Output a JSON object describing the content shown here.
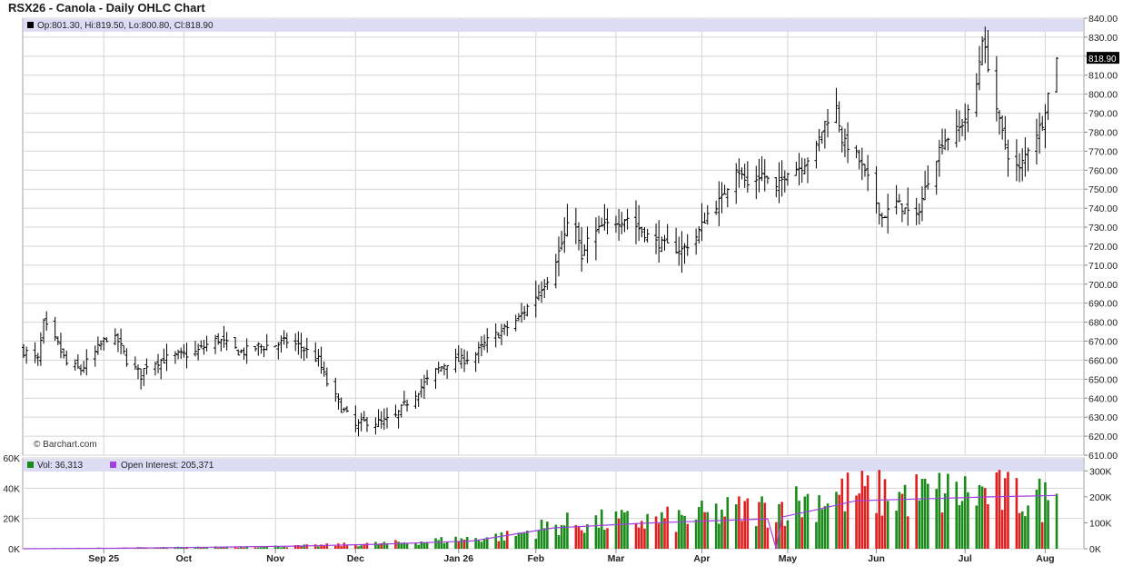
{
  "chart_data": [
    {
      "type": "ohlc",
      "title": "RSX26 - Canola - Daily OHLC Chart",
      "watermark": "© Barchart.com",
      "legend": {
        "open_label": "Op:",
        "open": "801.30",
        "high_label": "Hi:",
        "high": "819.50",
        "low_label": "Lo:",
        "low": "800.80",
        "close_label": "Cl:",
        "close": "818.90"
      },
      "last_price_label": "818.90",
      "ylim": [
        610,
        840
      ],
      "y_ticks": [
        "840.00",
        "830.00",
        "820.00",
        "810.00",
        "800.00",
        "790.00",
        "780.00",
        "770.00",
        "760.00",
        "750.00",
        "740.00",
        "730.00",
        "720.00",
        "710.00",
        "700.00",
        "690.00",
        "680.00",
        "670.00",
        "660.00",
        "650.00",
        "640.00",
        "630.00",
        "620.00",
        "610.00"
      ],
      "x_ticks": [
        "Sep 25",
        "Oct",
        "Nov",
        "Dec",
        "Jan 26",
        "Feb",
        "Mar",
        "Apr",
        "May",
        "Jun",
        "Jul",
        "Aug"
      ],
      "close_series": [
        {
          "d": "2025-08-28",
          "v": 665
        },
        {
          "d": "2025-09-02",
          "v": 660
        },
        {
          "d": "2025-09-04",
          "v": 679
        },
        {
          "d": "2025-09-09",
          "v": 668
        },
        {
          "d": "2025-09-12",
          "v": 658
        },
        {
          "d": "2025-09-17",
          "v": 655
        },
        {
          "d": "2025-09-22",
          "v": 664
        },
        {
          "d": "2025-09-26",
          "v": 672
        },
        {
          "d": "2025-09-30",
          "v": 670
        },
        {
          "d": "2025-10-03",
          "v": 660
        },
        {
          "d": "2025-10-08",
          "v": 652
        },
        {
          "d": "2025-10-10",
          "v": 658
        },
        {
          "d": "2025-10-15",
          "v": 660
        },
        {
          "d": "2025-10-20",
          "v": 662
        },
        {
          "d": "2025-10-27",
          "v": 664
        },
        {
          "d": "2025-10-31",
          "v": 668
        },
        {
          "d": "2025-11-04",
          "v": 671
        },
        {
          "d": "2025-11-07",
          "v": 668
        },
        {
          "d": "2025-11-12",
          "v": 664
        },
        {
          "d": "2025-11-18",
          "v": 667
        },
        {
          "d": "2025-11-24",
          "v": 668
        },
        {
          "d": "2025-11-28",
          "v": 670
        },
        {
          "d": "2025-12-03",
          "v": 667
        },
        {
          "d": "2025-12-09",
          "v": 660
        },
        {
          "d": "2025-12-12",
          "v": 648
        },
        {
          "d": "2025-12-17",
          "v": 635
        },
        {
          "d": "2025-12-22",
          "v": 625
        },
        {
          "d": "2025-12-26",
          "v": 628
        },
        {
          "d": "2025-12-31",
          "v": 627
        },
        {
          "d": "2026-01-05",
          "v": 630
        },
        {
          "d": "2026-01-09",
          "v": 638
        },
        {
          "d": "2026-01-14",
          "v": 646
        },
        {
          "d": "2026-01-19",
          "v": 654
        },
        {
          "d": "2026-01-23",
          "v": 659
        },
        {
          "d": "2026-01-28",
          "v": 660
        },
        {
          "d": "2026-02-02",
          "v": 663
        },
        {
          "d": "2026-02-06",
          "v": 670
        },
        {
          "d": "2026-02-11",
          "v": 675
        },
        {
          "d": "2026-02-17",
          "v": 682
        },
        {
          "d": "2026-02-23",
          "v": 694
        },
        {
          "d": "2026-02-27",
          "v": 703
        },
        {
          "d": "2026-03-03",
          "v": 717
        },
        {
          "d": "2026-03-06",
          "v": 730
        },
        {
          "d": "2026-03-09",
          "v": 732
        },
        {
          "d": "2026-03-11",
          "v": 712
        },
        {
          "d": "2026-03-13",
          "v": 723
        },
        {
          "d": "2026-03-18",
          "v": 730
        },
        {
          "d": "2026-03-23",
          "v": 733
        },
        {
          "d": "2026-03-27",
          "v": 735
        },
        {
          "d": "2026-04-01",
          "v": 728
        },
        {
          "d": "2026-04-06",
          "v": 722
        },
        {
          "d": "2026-04-10",
          "v": 720
        },
        {
          "d": "2026-04-15",
          "v": 718
        },
        {
          "d": "2026-04-20",
          "v": 725
        },
        {
          "d": "2026-04-24",
          "v": 737
        },
        {
          "d": "2026-04-29",
          "v": 745
        },
        {
          "d": "2026-05-04",
          "v": 762
        },
        {
          "d": "2026-05-08",
          "v": 752
        },
        {
          "d": "2026-05-13",
          "v": 758
        },
        {
          "d": "2026-05-18",
          "v": 750
        },
        {
          "d": "2026-05-22",
          "v": 760
        },
        {
          "d": "2026-05-27",
          "v": 762
        },
        {
          "d": "2026-06-01",
          "v": 772
        },
        {
          "d": "2026-06-04",
          "v": 785
        },
        {
          "d": "2026-06-08",
          "v": 793
        },
        {
          "d": "2026-06-10",
          "v": 776
        },
        {
          "d": "2026-06-15",
          "v": 768
        },
        {
          "d": "2026-06-19",
          "v": 755
        },
        {
          "d": "2026-06-24",
          "v": 735
        },
        {
          "d": "2026-06-29",
          "v": 743
        },
        {
          "d": "2026-07-03",
          "v": 738
        },
        {
          "d": "2026-07-06",
          "v": 735
        },
        {
          "d": "2026-07-10",
          "v": 755
        },
        {
          "d": "2026-07-15",
          "v": 775
        },
        {
          "d": "2026-07-21",
          "v": 782
        },
        {
          "d": "2026-07-24",
          "v": 790
        },
        {
          "d": "2026-07-27",
          "v": 805
        },
        {
          "d": "2026-07-29",
          "v": 830
        },
        {
          "d": "2026-07-31",
          "v": 815
        },
        {
          "d": "2026-08-04",
          "v": 785
        },
        {
          "d": "2026-08-07",
          "v": 768
        },
        {
          "d": "2026-08-11",
          "v": 760
        },
        {
          "d": "2026-08-14",
          "v": 772
        },
        {
          "d": "2026-08-19",
          "v": 785
        },
        {
          "d": "2026-08-21",
          "v": 800
        },
        {
          "d": "2026-08-24",
          "v": 818.9
        }
      ]
    },
    {
      "type": "bar",
      "title": "",
      "legend": {
        "vol_label": "Vol:",
        "vol": "36,313",
        "oi_label": "Open Interest:",
        "oi": "205,371"
      },
      "left_axis_ticks": [
        "60K",
        "40K",
        "20K",
        "0K"
      ],
      "right_axis_ticks": [
        "300K",
        "200K",
        "100K",
        "0K"
      ],
      "volume_ylim": [
        0,
        60000
      ],
      "open_interest_ylim": [
        0,
        350000
      ],
      "volume_envelope": [
        {
          "d": "2025-08-28",
          "v": 250
        },
        {
          "d": "2025-10-01",
          "v": 800
        },
        {
          "d": "2025-11-01",
          "v": 1200
        },
        {
          "d": "2025-12-01",
          "v": 2000
        },
        {
          "d": "2026-01-01",
          "v": 4000
        },
        {
          "d": "2026-01-26",
          "v": 7000
        },
        {
          "d": "2026-02-15",
          "v": 10000
        },
        {
          "d": "2026-03-01",
          "v": 18000
        },
        {
          "d": "2026-03-15",
          "v": 20000
        },
        {
          "d": "2026-04-15",
          "v": 22000
        },
        {
          "d": "2026-05-01",
          "v": 28000
        },
        {
          "d": "2026-05-15",
          "v": 30000
        },
        {
          "d": "2026-06-01",
          "v": 38000
        },
        {
          "d": "2026-06-15",
          "v": 42000
        },
        {
          "d": "2026-07-01",
          "v": 40000
        },
        {
          "d": "2026-07-15",
          "v": 42000
        },
        {
          "d": "2026-08-01",
          "v": 42000
        },
        {
          "d": "2026-08-15",
          "v": 38000
        },
        {
          "d": "2026-08-24",
          "v": 36313
        }
      ],
      "open_interest": [
        {
          "d": "2025-08-28",
          "v": 0
        },
        {
          "d": "2025-10-01",
          "v": 2000
        },
        {
          "d": "2025-11-01",
          "v": 6000
        },
        {
          "d": "2025-12-01",
          "v": 10000
        },
        {
          "d": "2026-01-01",
          "v": 18000
        },
        {
          "d": "2026-02-01",
          "v": 30000
        },
        {
          "d": "2026-03-01",
          "v": 80000
        },
        {
          "d": "2026-04-01",
          "v": 98000
        },
        {
          "d": "2026-05-01",
          "v": 110000
        },
        {
          "d": "2026-05-15",
          "v": 115000
        },
        {
          "d": "2026-05-18",
          "v": 0
        },
        {
          "d": "2026-05-20",
          "v": 122000
        },
        {
          "d": "2026-06-01",
          "v": 150000
        },
        {
          "d": "2026-06-15",
          "v": 185000
        },
        {
          "d": "2026-07-01",
          "v": 190000
        },
        {
          "d": "2026-08-01",
          "v": 200000
        },
        {
          "d": "2026-08-24",
          "v": 205371
        }
      ]
    }
  ],
  "colors": {
    "price_bar": "#000000",
    "grid": "#d4d4d4",
    "legend_band": "#dcdcf5",
    "volume_up": "#1a8a1a",
    "volume_down": "#e02020",
    "volume_flagged": "#e89a80",
    "open_interest_line": "#a040e0",
    "last_price_box": "#000000"
  }
}
